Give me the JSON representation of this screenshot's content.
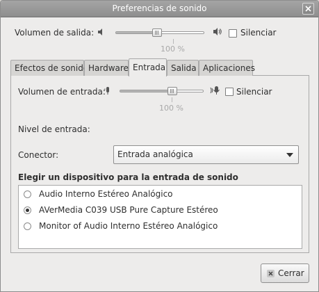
{
  "window": {
    "title": "Preferencias de sonido"
  },
  "output": {
    "volume_label": "Volumen de salida:",
    "volume_percent": 100,
    "volume_text": "100 %",
    "mute_label": "Silenciar",
    "mute_checked": false
  },
  "tabs": [
    {
      "label": "Efectos de sonido",
      "active": false
    },
    {
      "label": "Hardware",
      "active": false
    },
    {
      "label": "Entrada",
      "active": true
    },
    {
      "label": "Salida",
      "active": false
    },
    {
      "label": "Aplicaciones",
      "active": false
    }
  ],
  "input": {
    "volume_label": "Volumen de entrada:",
    "volume_percent": 100,
    "volume_text": "100 %",
    "mute_label": "Silenciar",
    "mute_checked": false,
    "level_label": "Nivel de entrada:",
    "connector_label": "Conector:",
    "connector_value": "Entrada analógica",
    "device_heading": "Elegir un dispositivo para la entrada de sonido",
    "devices": [
      {
        "label": "Audio Interno Estéreo Analógico",
        "selected": false
      },
      {
        "label": "AVerMedia C039 USB Pure Capture Estéreo",
        "selected": true
      },
      {
        "label": "Monitor of Audio Interno Estéreo Analógico",
        "selected": false
      }
    ]
  },
  "footer": {
    "close_label": "Cerrar"
  },
  "icons": {
    "speaker_low": "speaker-low-icon",
    "speaker_high": "speaker-high-icon",
    "mic_low": "microphone-low-icon",
    "mic_high": "microphone-high-icon",
    "close": "close-icon",
    "cancel": "cancel-icon"
  }
}
